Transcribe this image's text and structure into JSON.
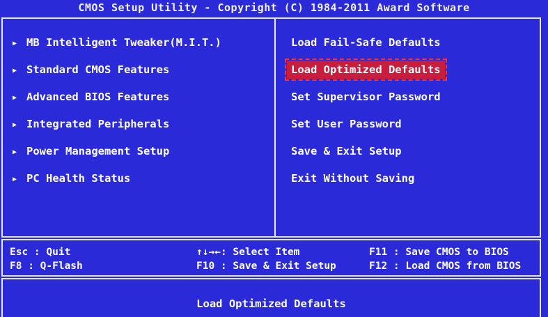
{
  "title": "CMOS Setup Utility - Copyright (C) 1984-2011 Award Software",
  "left_menu": [
    {
      "label": "MB Intelligent Tweaker(M.I.T.)"
    },
    {
      "label": "Standard CMOS Features"
    },
    {
      "label": "Advanced BIOS Features"
    },
    {
      "label": "Integrated Peripherals"
    },
    {
      "label": "Power Management Setup"
    },
    {
      "label": "PC Health Status"
    }
  ],
  "submenu_marker_icon": "right-triangle-icon",
  "right_menu": [
    {
      "label": "Load Fail-Safe Defaults"
    },
    {
      "label": "Load Optimized Defaults",
      "selected": true
    },
    {
      "label": "Set Supervisor Password"
    },
    {
      "label": "Set User Password"
    },
    {
      "label": "Save & Exit Setup"
    },
    {
      "label": "Exit Without Saving"
    }
  ],
  "help": {
    "esc_quit": "Esc  : Quit",
    "f8_qflash": "F8   : Q-Flash",
    "arrows_select": "↑↓→←: Select Item",
    "f10_save": "F10 : Save & Exit Setup",
    "f11_save_cmos": "F11 : Save CMOS to BIOS",
    "f12_load_cmos": "F12 : Load CMOS from BIOS"
  },
  "status": "Load Optimized Defaults",
  "colors": {
    "background": "#2a2ad8",
    "selected_bg": "#c81e3e",
    "text": "#ffffff",
    "border": "#e8e8ff"
  }
}
